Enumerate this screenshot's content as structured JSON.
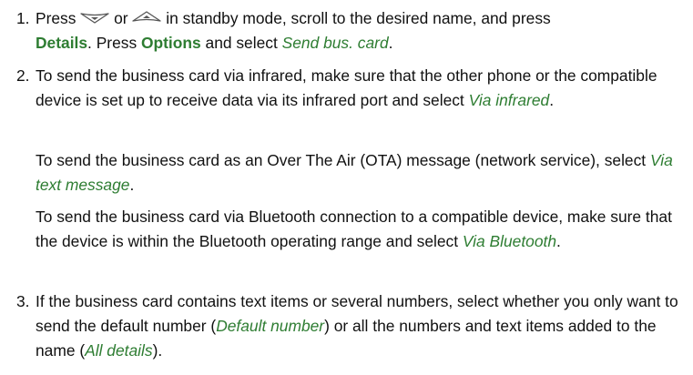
{
  "steps": [
    {
      "number": "1.",
      "t_a": "Press ",
      "t_or": " or ",
      "t_b": " in standby mode, scroll to the desired name, and press",
      "ui_details": "Details",
      "t_c": ". Press ",
      "ui_options": "Options",
      "t_d": " and select ",
      "opt_send": "Send bus. card",
      "t_e": ".",
      "icons": [
        "scroll-down-key-icon",
        "scroll-up-key-icon"
      ]
    },
    {
      "number": "2.",
      "p1_text": "To send the business card via infrared, make sure that the other phone or the compatible device is set up to receive data via its infrared port and select ",
      "p1_opt": "Via infrared",
      "p1_end": ".",
      "p2_text": "To send the business card as an Over The Air (OTA) message (network service), select ",
      "p2_opt": "Via text message",
      "p2_end": ".",
      "p3_text": "To send the business card via Bluetooth connection to a compatible device, make sure that the device is within the Bluetooth operating range and select ",
      "p3_opt": "Via Bluetooth",
      "p3_end": "."
    },
    {
      "number": "3.",
      "t_a": "If the business card contains text items or several numbers, select whether you only want to send the default number (",
      "opt_default": "Default number",
      "t_b": ") or all the numbers and text items added to the name (",
      "opt_all": "All details",
      "t_c": ")."
    }
  ],
  "colors": {
    "text": "#111111",
    "accent_green": "#2e7d32",
    "icon_stroke": "#555555"
  }
}
